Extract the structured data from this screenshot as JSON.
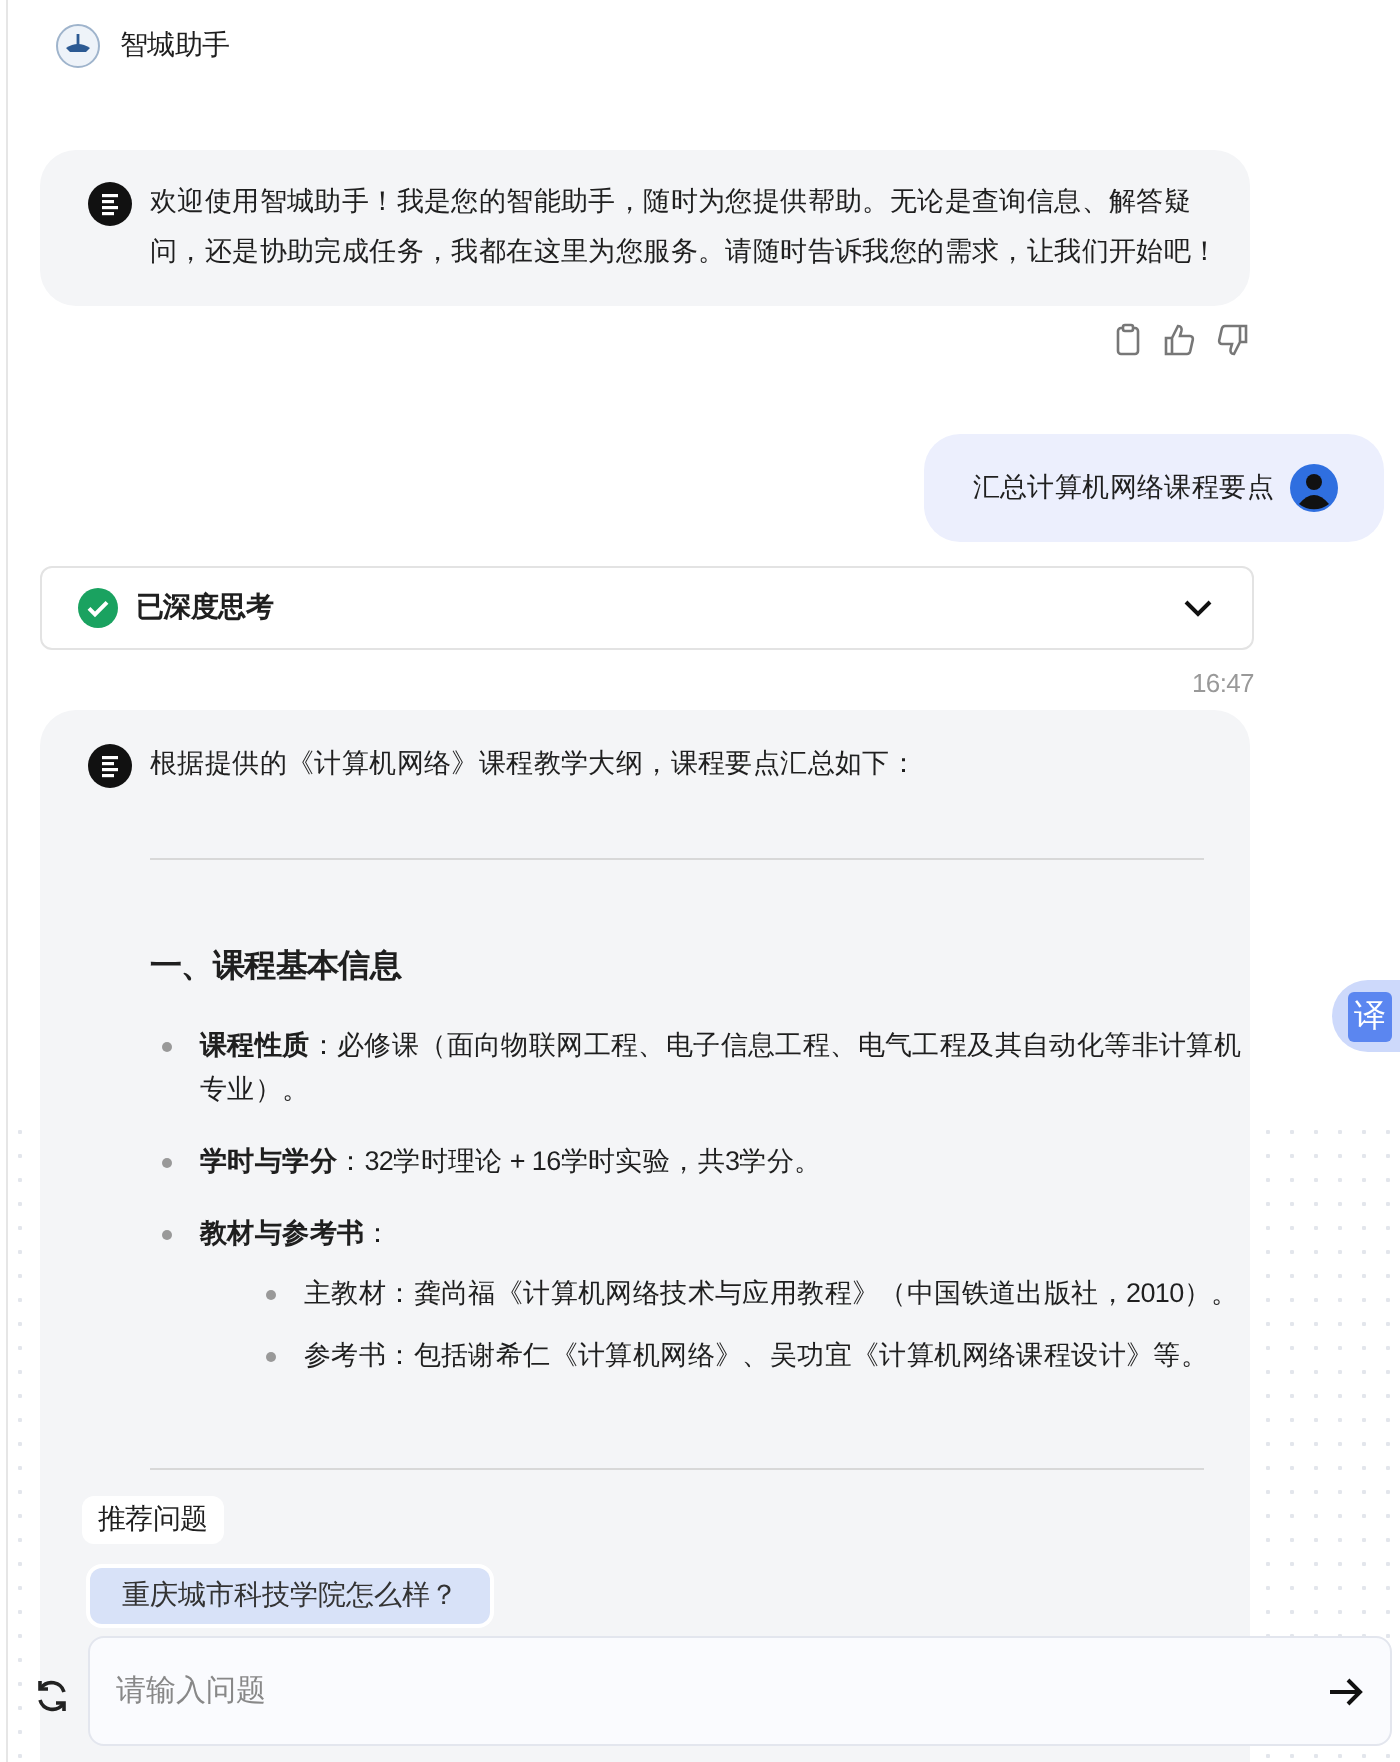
{
  "header": {
    "title": "智城助手"
  },
  "welcome": {
    "text": "欢迎使用智城助手！我是您的智能助手，随时为您提供帮助。无论是查询信息、解答疑问，还是协助完成任务，我都在这里为您服务。请随时告诉我您的需求，让我们开始吧！"
  },
  "user_message": {
    "text": "汇总计算机网络课程要点"
  },
  "thinking": {
    "label": "已深度思考",
    "expanded": false
  },
  "timestamp": "16:47",
  "answer": {
    "intro": "根据提供的《计算机网络》课程教学大纲，课程要点汇总如下：",
    "sections": [
      {
        "heading": "一、课程基本信息",
        "items": [
          {
            "text": "**课程性质**：必修课（面向物联网工程、电子信息工程、电气工程及其自动化等非计算机专业）。"
          },
          {
            "text": "**学时与学分**：32学时理论 + 16学时实验，共3学分。"
          },
          {
            "text": "**教材与参考书**：",
            "children": [
              {
                "text": "主教材：龚尚福《计算机网络技术与应用教程》（中国铁道出版社，2010）。"
              },
              {
                "text": "参考书：包括谢希仁《计算机网络》、吴功宜《计算机网络课程设计》等。"
              }
            ]
          }
        ]
      }
    ]
  },
  "suggestions": {
    "title": "推荐问题",
    "items": [
      "重庆城市科技学院怎么样？"
    ]
  },
  "input": {
    "placeholder": "请输入问题"
  },
  "translate_button": {
    "label": "译"
  }
}
